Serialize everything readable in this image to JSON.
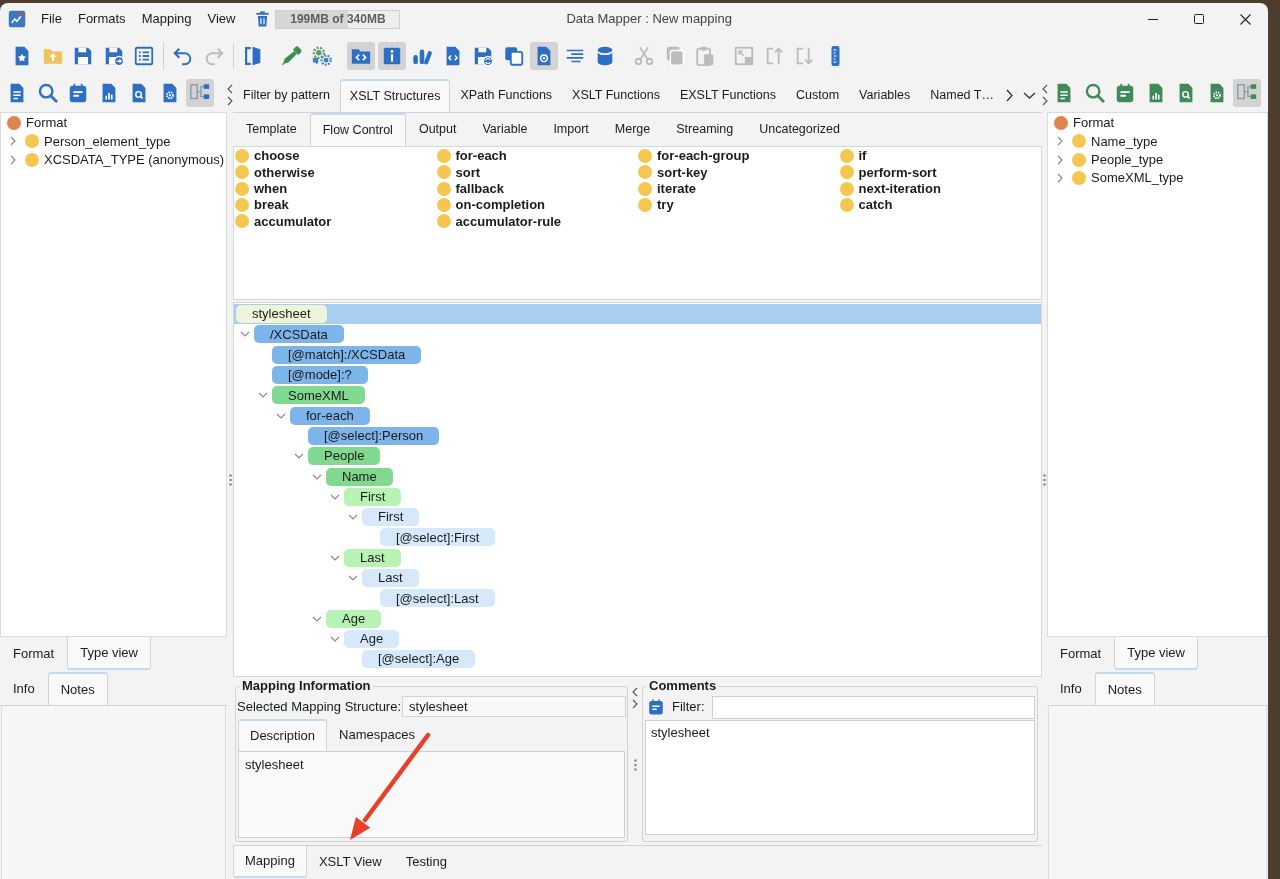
{
  "window": {
    "title": "Data Mapper : New mapping"
  },
  "menu": [
    "File",
    "Formats",
    "Mapping",
    "View"
  ],
  "memory": {
    "label": "199MB of 340MB",
    "level": 0.585
  },
  "toolbar": [
    {
      "kind": "group",
      "buttons": [
        {
          "pressed": false,
          "disabled": false
        },
        {
          "pressed": false,
          "disabled": false
        },
        {
          "pressed": false,
          "disabled": false
        },
        {
          "pressed": false,
          "disabled": false
        },
        {
          "pressed": false,
          "disabled": false
        }
      ]
    },
    {
      "kind": "separator"
    },
    {
      "kind": "group",
      "buttons": [
        {
          "pressed": false,
          "disabled": false
        },
        {
          "pressed": false,
          "disabled": true
        }
      ]
    },
    {
      "kind": "separator"
    },
    {
      "kind": "group",
      "buttons": [
        {
          "pressed": false,
          "disabled": false
        }
      ]
    },
    {
      "kind": "group",
      "buttons": [
        {
          "pressed": false,
          "disabled": false
        },
        {
          "pressed": false,
          "disabled": false
        }
      ]
    },
    {
      "kind": "group",
      "buttons": [
        {
          "pressed": true,
          "disabled": false
        },
        {
          "pressed": true,
          "disabled": false
        },
        {
          "pressed": false,
          "disabled": false
        },
        {
          "pressed": false,
          "disabled": false
        },
        {
          "pressed": false,
          "disabled": false
        },
        {
          "pressed": false,
          "disabled": false
        },
        {
          "pressed": true,
          "disabled": false
        },
        {
          "pressed": false,
          "disabled": false
        },
        {
          "pressed": false,
          "disabled": false
        }
      ]
    },
    {
      "kind": "group",
      "buttons": [
        {
          "pressed": false,
          "disabled": true
        },
        {
          "pressed": false,
          "disabled": true
        },
        {
          "pressed": false,
          "disabled": true
        }
      ]
    },
    {
      "kind": "group",
      "buttons": [
        {
          "pressed": false,
          "disabled": true
        },
        {
          "pressed": false,
          "disabled": true
        },
        {
          "pressed": false,
          "disabled": true
        },
        {
          "pressed": false,
          "disabled": false
        }
      ]
    }
  ],
  "left_panel": {
    "tools": [
      {
        "pressed": false
      },
      {
        "pressed": false
      },
      {
        "pressed": false
      },
      {
        "pressed": false
      },
      {
        "pressed": false
      },
      {
        "pressed": false
      },
      {
        "pressed": true
      }
    ],
    "tree": [
      {
        "label": "Format",
        "color": "#e0844f",
        "children": [
          {
            "label": "Person_element_type",
            "color": "#f6c750",
            "expanded": false
          },
          {
            "label": "XCSDATA_TYPE (anonymous)",
            "color": "#f6c750",
            "expanded": false
          }
        ]
      }
    ],
    "view_tabs": [
      {
        "label": "Format",
        "selected": false
      },
      {
        "label": "Type view",
        "selected": true
      }
    ],
    "info_tabs": [
      {
        "label": "Info",
        "selected": false
      },
      {
        "label": "Notes",
        "selected": true
      }
    ]
  },
  "center": {
    "tabs": [
      {
        "label": "Filter by pattern",
        "selected": false
      },
      {
        "label": "XSLT Structures",
        "selected": true
      },
      {
        "label": "XPath Functions",
        "selected": false
      },
      {
        "label": "XSLT Functions",
        "selected": false
      },
      {
        "label": "EXSLT Functions",
        "selected": false
      },
      {
        "label": "Custom",
        "selected": false
      },
      {
        "label": "Variables",
        "selected": false
      },
      {
        "label": "Named T…",
        "selected": false
      }
    ],
    "subtabs": [
      {
        "label": "Template",
        "selected": false
      },
      {
        "label": "Flow Control",
        "selected": true
      },
      {
        "label": "Output",
        "selected": false
      },
      {
        "label": "Variable",
        "selected": false
      },
      {
        "label": "Import",
        "selected": false
      },
      {
        "label": "Merge",
        "selected": false
      },
      {
        "label": "Streaming",
        "selected": false
      },
      {
        "label": "Uncategorized",
        "selected": false
      }
    ],
    "element_columns": [
      [
        "choose",
        "otherwise",
        "when",
        "break",
        "accumulator"
      ],
      [
        "for-each",
        "sort",
        "fallback",
        "on-completion",
        "accumulator-rule"
      ],
      [
        "for-each-group",
        "sort-key",
        "iterate",
        "try"
      ],
      [
        "if",
        "perform-sort",
        "next-iteration",
        "catch"
      ]
    ],
    "mapping_tree": [
      {
        "label": "stylesheet",
        "color": "#eef5d8",
        "selected": true,
        "children": [
          {
            "label": "/XCSData",
            "color": "#7db4ea",
            "selected": false,
            "expanded": true,
            "children": [
              {
                "label": "[@match]:/XCSData",
                "color": "#7db4ea",
                "selected": false
              },
              {
                "label": "[@mode]:?",
                "color": "#7db4ea",
                "selected": false
              },
              {
                "label": "SomeXML",
                "color": "#80d98f",
                "selected": false,
                "expanded": true,
                "children": [
                  {
                    "label": "for-each",
                    "color": "#7db4ea",
                    "selected": false,
                    "expanded": true,
                    "children": [
                      {
                        "label": "[@select]:Person",
                        "color": "#7db4ea",
                        "selected": false
                      },
                      {
                        "label": "People",
                        "color": "#80d98f",
                        "selected": false,
                        "expanded": true,
                        "children": [
                          {
                            "label": "Name",
                            "color": "#80d98f",
                            "selected": false,
                            "expanded": true,
                            "children": [
                              {
                                "label": "First",
                                "color": "#b6f3b4",
                                "selected": false,
                                "expanded": true,
                                "children": [
                                  {
                                    "label": "First",
                                    "color": "#d6e9fb",
                                    "selected": false,
                                    "expanded": true,
                                    "children": [
                                      {
                                        "label": "[@select]:First",
                                        "color": "#d6e9fb",
                                        "selected": false
                                      }
                                    ]
                                  }
                                ]
                              },
                              {
                                "label": "Last",
                                "color": "#b6f3b4",
                                "selected": false,
                                "expanded": true,
                                "children": [
                                  {
                                    "label": "Last",
                                    "color": "#d6e9fb",
                                    "selected": false,
                                    "expanded": true,
                                    "children": [
                                      {
                                        "label": "[@select]:Last",
                                        "color": "#d6e9fb",
                                        "selected": false
                                      }
                                    ]
                                  }
                                ]
                              }
                            ]
                          },
                          {
                            "label": "Age",
                            "color": "#b6f3b4",
                            "selected": false,
                            "expanded": true,
                            "children": [
                              {
                                "label": "Age",
                                "color": "#d6e9fb",
                                "selected": false,
                                "expanded": true,
                                "children": [
                                  {
                                    "label": "[@select]:Age",
                                    "color": "#d6e9fb",
                                    "selected": false
                                  }
                                ]
                              }
                            ]
                          }
                        ]
                      }
                    ]
                  }
                ]
              }
            ]
          }
        ]
      }
    ],
    "mapping_info": {
      "title": "Mapping Information",
      "structure_label": "Selected Mapping Structure:",
      "structure_value": "stylesheet",
      "tabs": [
        {
          "label": "Description",
          "selected": true
        },
        {
          "label": "Namespaces",
          "selected": false
        }
      ],
      "description": "stylesheet"
    },
    "comments": {
      "title": "Comments",
      "filter_label": "Filter:",
      "items": [
        "stylesheet"
      ]
    },
    "bottom_tabs": [
      {
        "label": "Mapping",
        "selected": true
      },
      {
        "label": "XSLT View",
        "selected": false
      },
      {
        "label": "Testing",
        "selected": false
      }
    ]
  },
  "right_panel": {
    "tools": [
      {
        "pressed": false
      },
      {
        "pressed": false
      },
      {
        "pressed": false
      },
      {
        "pressed": false
      },
      {
        "pressed": false
      },
      {
        "pressed": false
      },
      {
        "pressed": true
      }
    ],
    "tree": [
      {
        "label": "Format",
        "color": "#e0844f",
        "children": [
          {
            "label": "Name_type",
            "color": "#f6c750",
            "expanded": false
          },
          {
            "label": "People_type",
            "color": "#f6c750",
            "expanded": false
          },
          {
            "label": "SomeXML_type",
            "color": "#f6c750",
            "expanded": false
          }
        ]
      }
    ],
    "view_tabs": [
      {
        "label": "Format",
        "selected": false
      },
      {
        "label": "Type view",
        "selected": true
      }
    ],
    "info_tabs": [
      {
        "label": "Info",
        "selected": false
      },
      {
        "label": "Notes",
        "selected": true
      }
    ]
  }
}
